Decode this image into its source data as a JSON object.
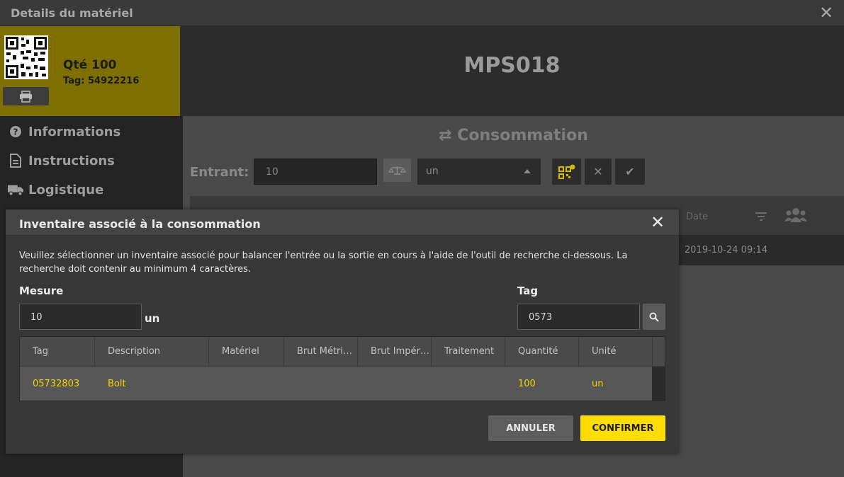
{
  "window": {
    "title": "Details du matériel"
  },
  "card": {
    "qty": "Qté 100",
    "tag": "Tag: 54922216"
  },
  "header": {
    "code": "MPS018"
  },
  "sidebar": {
    "items": [
      {
        "label": "Informations",
        "icon": "question-circle-icon"
      },
      {
        "label": "Instructions",
        "icon": "document-icon"
      },
      {
        "label": "Logistique",
        "icon": "truck-icon"
      }
    ]
  },
  "main": {
    "title": "Consommation",
    "entrant_label": "Entrant:",
    "entrant_value": "10",
    "unit_value": "un",
    "table": {
      "date_header": "Date",
      "date_value": "2019-10-24 09:14"
    }
  },
  "modal": {
    "title": "Inventaire associé à la consommation",
    "description": "Veuillez sélectionner un inventaire associé pour balancer l'entrée ou la sortie en cours à l'aide de l'outil de recherche ci-dessous. La recherche doit contenir au minimum 4 caractères.",
    "mesure_label": "Mesure",
    "mesure_value": "10",
    "mesure_unit": "un",
    "tag_label": "Tag",
    "tag_value": "0573",
    "columns": [
      "Tag",
      "Description",
      "Matériel",
      "Brut Métri…",
      "Brut Impér…",
      "Traitement",
      "Quantité",
      "Unité"
    ],
    "rows": [
      {
        "tag": "05732803",
        "description": "Bolt",
        "materiel": "",
        "brut_metrique": "",
        "brut_imperial": "",
        "traitement": "",
        "quantite": "100",
        "unite": "un"
      }
    ],
    "cancel_label": "ANNULER",
    "confirm_label": "CONFIRMER"
  },
  "colors": {
    "accent": "#ffdd00",
    "card_bg": "#7f6e00",
    "row_text": "#f5d400"
  }
}
